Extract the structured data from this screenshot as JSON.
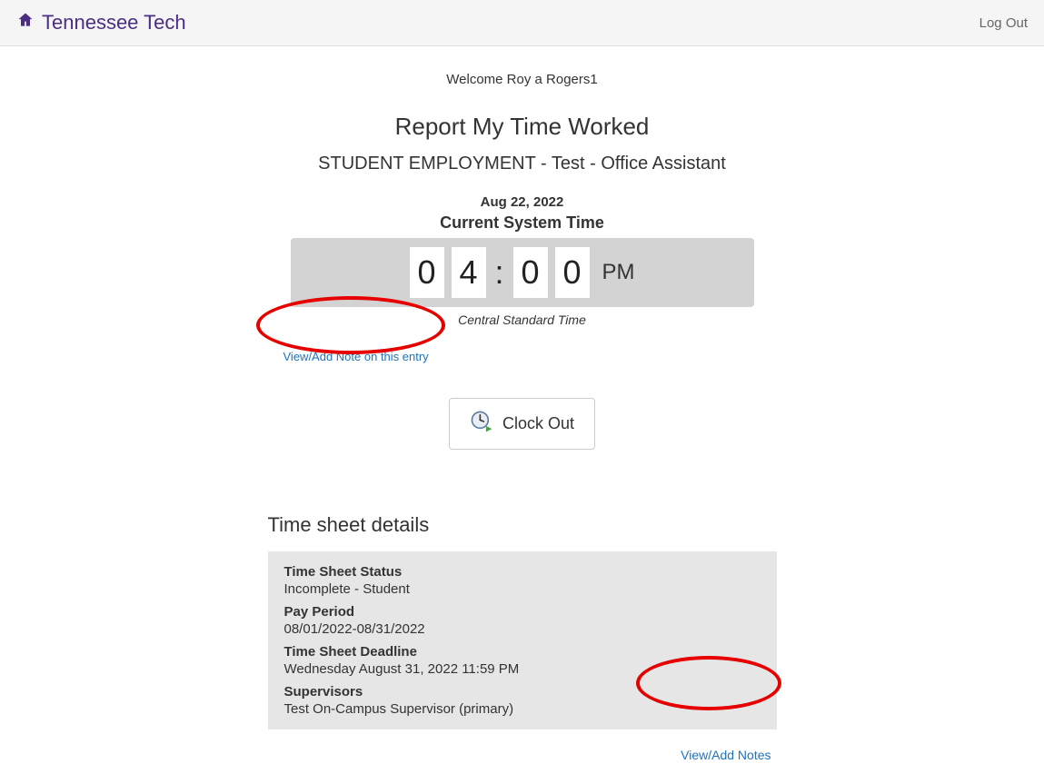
{
  "header": {
    "brand": "Tennessee Tech",
    "logout": "Log Out"
  },
  "welcome": "Welcome Roy a Rogers1",
  "page_title": "Report My Time Worked",
  "position": "STUDENT EMPLOYMENT - Test - Office Assistant",
  "date": "Aug 22, 2022",
  "system_time_label": "Current System Time",
  "clock": {
    "d1": "0",
    "d2": "4",
    "colon": ":",
    "d3": "0",
    "d4": "0",
    "ampm": "PM"
  },
  "timezone": "Central Standard Time",
  "view_add_note_entry": "View/Add Note on this entry",
  "clock_out": "Clock Out",
  "details": {
    "heading": "Time sheet details",
    "status_label": "Time Sheet Status",
    "status_value": "Incomplete - Student",
    "payperiod_label": "Pay Period",
    "payperiod_value": "08/01/2022-08/31/2022",
    "deadline_label": "Time Sheet Deadline",
    "deadline_value": "Wednesday August 31, 2022 11:59 PM",
    "supervisors_label": "Supervisors",
    "supervisors_value": "Test On-Campus Supervisor (primary)",
    "view_add_notes": "View/Add Notes"
  }
}
